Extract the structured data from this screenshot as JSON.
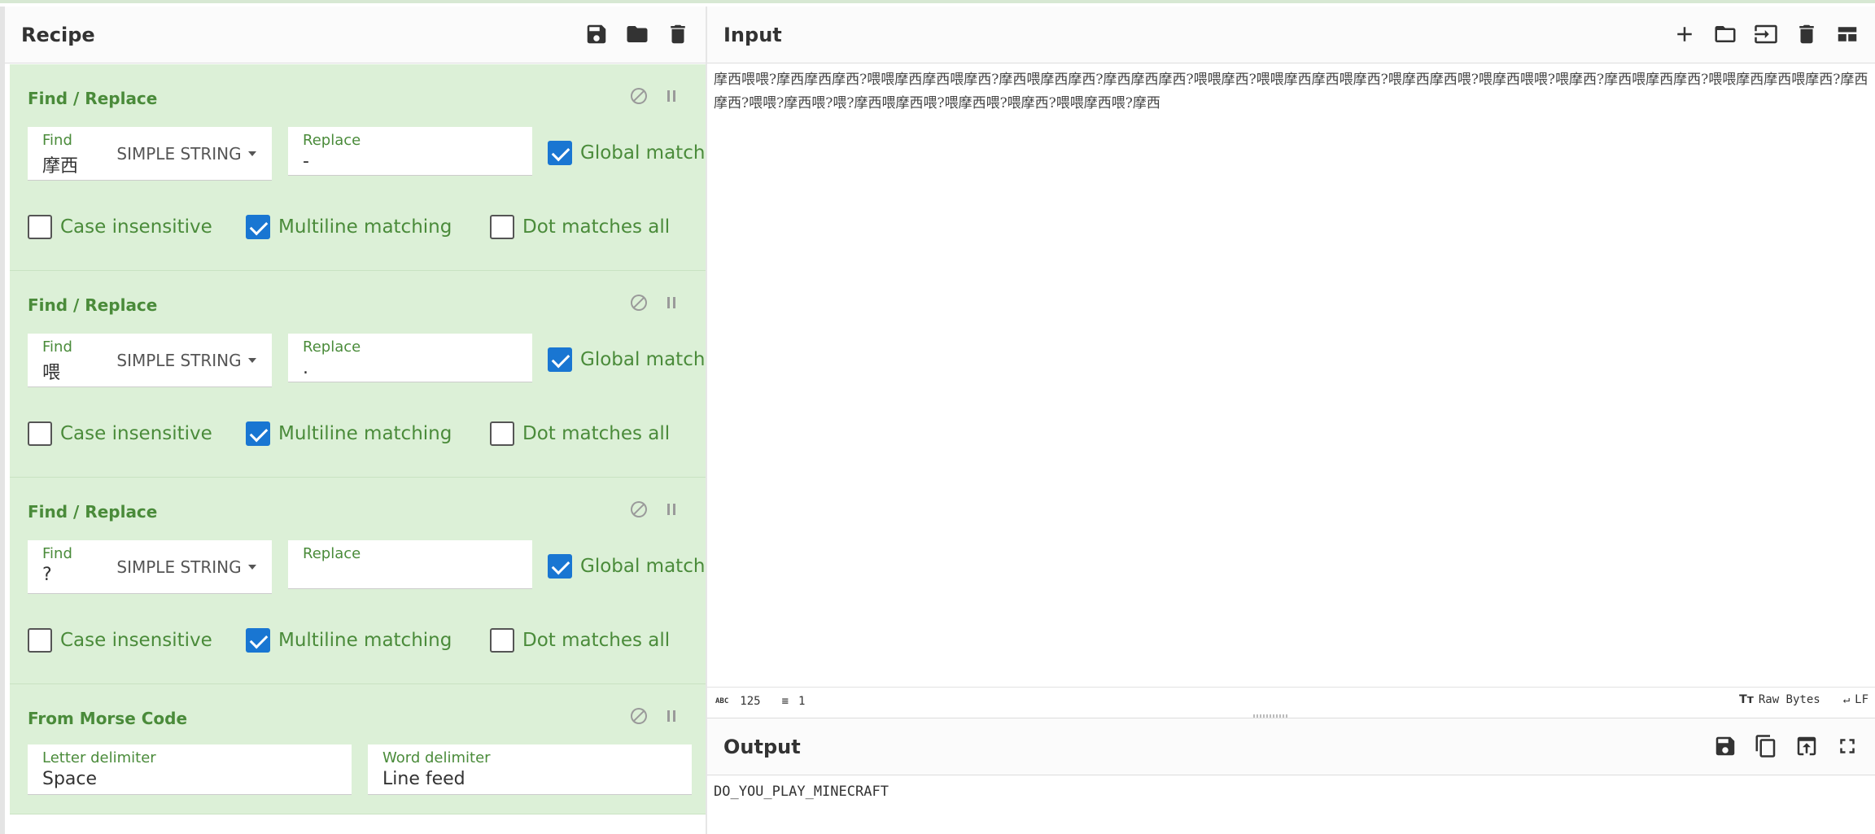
{
  "recipe": {
    "title": "Recipe",
    "icons": [
      "save-icon",
      "folder-icon",
      "trash-icon"
    ],
    "operations": [
      {
        "title": "Find / Replace",
        "find_label": "Find",
        "find_value": "摩西",
        "mode": "SIMPLE STRING",
        "replace_label": "Replace",
        "replace_value": "-",
        "global_match": "Global match",
        "global_checked": true,
        "case_insensitive": "Case insensitive",
        "case_checked": false,
        "multiline": "Multiline matching",
        "multiline_checked": true,
        "dot_all": "Dot matches all",
        "dot_checked": false
      },
      {
        "title": "Find / Replace",
        "find_label": "Find",
        "find_value": "喂",
        "mode": "SIMPLE STRING",
        "replace_label": "Replace",
        "replace_value": ".",
        "global_match": "Global match",
        "global_checked": true,
        "case_insensitive": "Case insensitive",
        "case_checked": false,
        "multiline": "Multiline matching",
        "multiline_checked": true,
        "dot_all": "Dot matches all",
        "dot_checked": false
      },
      {
        "title": "Find / Replace",
        "find_label": "Find",
        "find_value": "?",
        "mode": "SIMPLE STRING",
        "replace_label": "Replace",
        "replace_value": "",
        "global_match": "Global match",
        "global_checked": true,
        "case_insensitive": "Case insensitive",
        "case_checked": false,
        "multiline": "Multiline matching",
        "multiline_checked": true,
        "dot_all": "Dot matches all",
        "dot_checked": false
      },
      {
        "title": "From Morse Code",
        "letter_label": "Letter delimiter",
        "letter_value": "Space",
        "word_label": "Word delimiter",
        "word_value": "Line feed"
      }
    ]
  },
  "input": {
    "title": "Input",
    "icons": [
      "plus-icon",
      "folder-icon",
      "import-icon",
      "trash-icon",
      "layout-icon"
    ],
    "text": "摩西喂喂?摩西摩西摩西?喂喂摩西摩西喂摩西?摩西喂摩西摩西?摩西摩西摩西?喂喂摩西?喂喂摩西摩西喂摩西?喂摩西摩西喂?喂摩西喂喂?喂摩西?摩西喂摩西摩西?喂喂摩西摩西喂摩西?摩西摩西?喂喂?摩西喂?喂?摩西喂摩西喂?喂摩西喂?喂摩西?喂喂摩西喂?摩西",
    "status": {
      "chars": "125",
      "lines": "1",
      "encoding": "Raw Bytes",
      "eol": "LF"
    }
  },
  "output": {
    "title": "Output",
    "icons": [
      "save-icon",
      "copy-icon",
      "replace-input-icon",
      "maximize-icon"
    ],
    "text": "DO_YOU_PLAY_MINECRAFT"
  },
  "colors": {
    "op_bg": "#dcf0d7",
    "accent_green": "#4a8b3a",
    "checkbox_blue": "#1976d2"
  }
}
